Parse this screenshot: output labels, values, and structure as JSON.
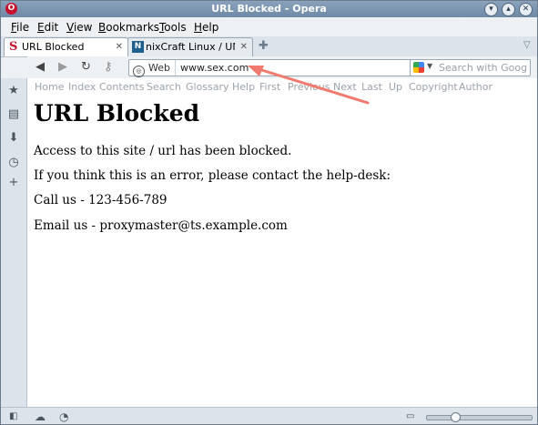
{
  "window": {
    "title": "URL Blocked - Opera"
  },
  "menu": [
    {
      "label": "File",
      "key": "F",
      "rest": "ile"
    },
    {
      "label": "Edit",
      "key": "E",
      "rest": "dit"
    },
    {
      "label": "View",
      "key": "V",
      "rest": "iew"
    },
    {
      "label": "Bookmarks",
      "key": "B",
      "rest": "ookmarks"
    },
    {
      "label": "Tools",
      "key": "T",
      "rest": "ools"
    },
    {
      "label": "Help",
      "key": "H",
      "rest": "elp"
    }
  ],
  "tabs": [
    {
      "label": "URL Blocked",
      "active": true
    },
    {
      "label": "nixCraft Linux / UNIX...",
      "active": false
    }
  ],
  "address": {
    "scope": "Web",
    "url": "www.sex.com",
    "search_placeholder": "Search with Goog"
  },
  "doc_nav": [
    "Home",
    "Index",
    "Contents",
    "Search",
    "Glossary",
    "Help",
    "First",
    "Previous",
    "Next",
    "Last",
    "Up",
    "Copyright",
    "Author"
  ],
  "page": {
    "heading": "URL Blocked",
    "line1": "Access to this site / url has been blocked.",
    "line2": "If you think this is an error, please contact the help-desk:",
    "line3": "Call us - 123-456-789",
    "line4": "Email us - proxymaster@ts.example.com"
  },
  "colors": {
    "arrow": "#f07a6e",
    "titlebar": "#7a94b0"
  },
  "icons": [
    "opera-logo-icon",
    "minimize-icon",
    "maximize-icon",
    "close-icon",
    "new-tab-icon",
    "back-icon",
    "forward-icon",
    "reload-icon",
    "key-icon",
    "bookmark-star-icon",
    "google-icon",
    "bookmarks-panel-icon",
    "notes-icon",
    "downloads-icon",
    "history-icon",
    "add-panel-icon",
    "cloud-icon",
    "speed-icon"
  ]
}
